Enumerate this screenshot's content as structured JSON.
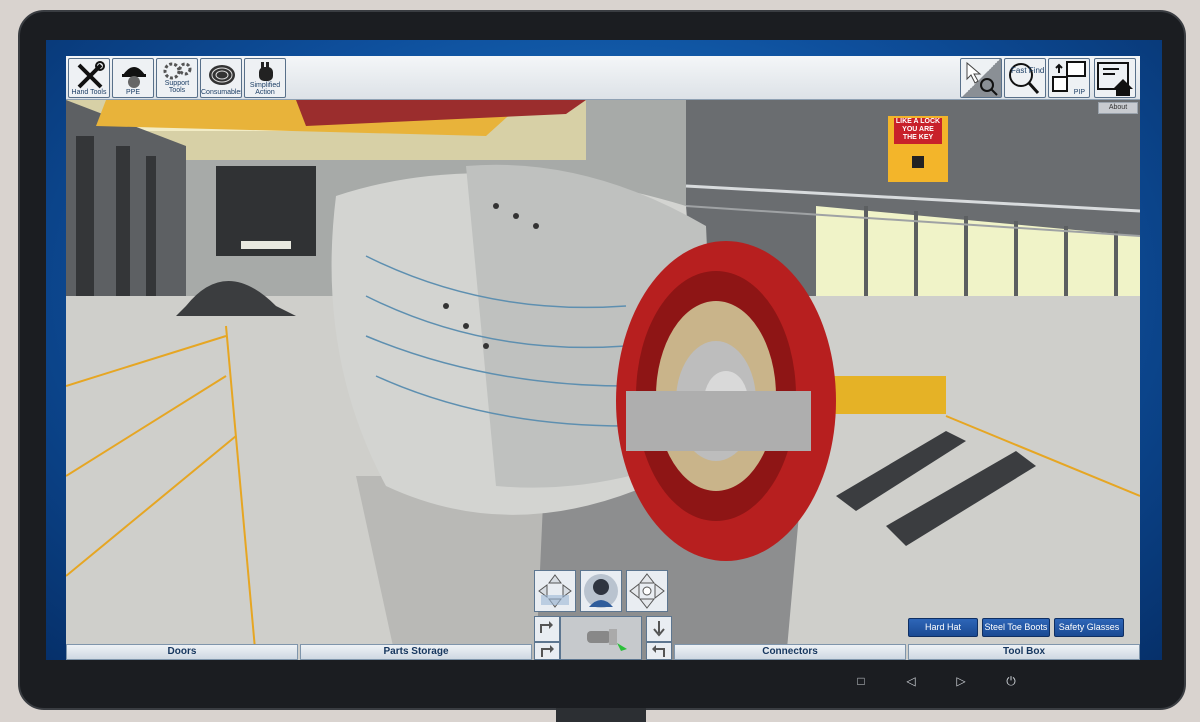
{
  "toolbar": {
    "tools": [
      {
        "label": "Hand Tools",
        "icon": "wrench-screwdriver-icon"
      },
      {
        "label": "PPE",
        "icon": "hard-hat-worker-icon"
      },
      {
        "label": "Support Tools",
        "icon": "gears-icon"
      },
      {
        "label": "Consumables",
        "icon": "wire-spool-icon"
      },
      {
        "label": "Simplified Action",
        "icon": "hand-icon"
      }
    ],
    "right": {
      "select_icon": "pointer-magnifier-icon",
      "fast_find_label": "Fast Find",
      "pip_label": "PIP",
      "home_icon": "home-menu-icon"
    },
    "about_label": "About"
  },
  "signage": {
    "poster_line1": "LIKE A LOCK",
    "poster_line2": "YOU ARE",
    "poster_line3": "THE KEY"
  },
  "bottom_tabs": {
    "doors": "Doors",
    "parts_storage": "Parts Storage",
    "connectors": "Connectors",
    "tool_box": "Tool Box"
  },
  "ppe_items": [
    "Hard Hat",
    "Steel Toe Boots",
    "Safety Glasses"
  ],
  "colors": {
    "accent": "#1f5aa8",
    "brand_red": "#b71f1f",
    "poster_yellow": "#f3b52a"
  }
}
